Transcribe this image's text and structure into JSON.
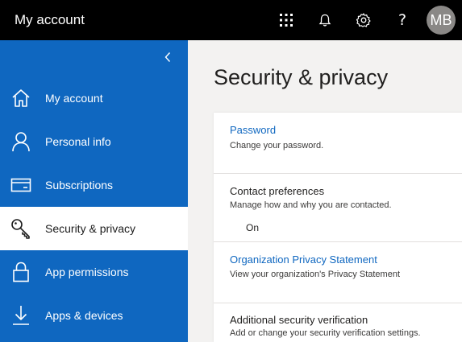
{
  "header": {
    "title": "My account",
    "icons": [
      "app-launcher-icon",
      "bell-icon",
      "gear-icon",
      "help-icon"
    ],
    "help_label": "?",
    "avatar_initials": "MB"
  },
  "sidebar": {
    "collapse_icon": "chevron-left-icon",
    "items": [
      {
        "label": "My account",
        "icon": "home-icon"
      },
      {
        "label": "Personal info",
        "icon": "person-icon"
      },
      {
        "label": "Subscriptions",
        "icon": "credit-card-icon"
      },
      {
        "label": "Security & privacy",
        "icon": "key-icon",
        "selected": true
      },
      {
        "label": "App permissions",
        "icon": "lock-icon"
      },
      {
        "label": "Apps & devices",
        "icon": "download-icon"
      }
    ]
  },
  "main": {
    "title": "Security & privacy",
    "rows": [
      {
        "title": "Password",
        "description": "Change your password.",
        "link": true
      },
      {
        "title": "Contact preferences",
        "description": "Manage how and why you are contacted.",
        "status": "On",
        "link": false
      },
      {
        "title": "Organization Privacy Statement",
        "description": "View your organization's Privacy Statement",
        "link": true
      },
      {
        "title": "Additional security verification",
        "description": "Add or change your security verification settings.",
        "link": false
      }
    ]
  },
  "colors": {
    "top_bar": "#000000",
    "sidebar": "#0f67c0",
    "link": "#0f67c0",
    "avatar": "#8a8886",
    "page_background": "#f3f2f1"
  }
}
